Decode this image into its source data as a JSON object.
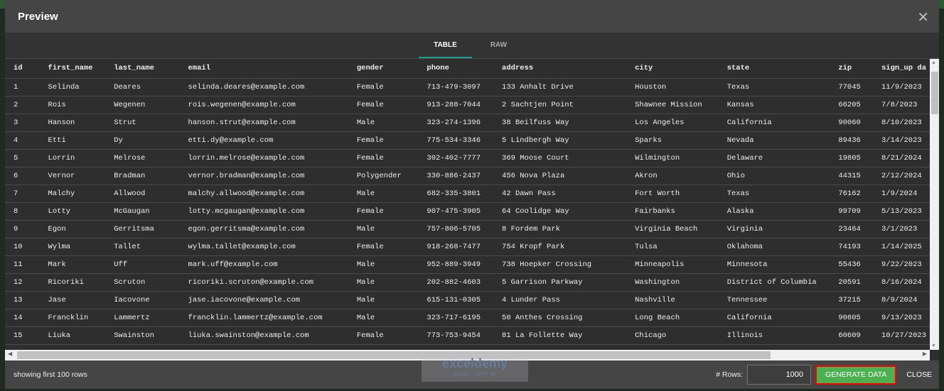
{
  "title": "Preview",
  "tabs": [
    "TABLE",
    "RAW"
  ],
  "columns": [
    "id",
    "first_name",
    "last_name",
    "email",
    "gender",
    "phone",
    "address",
    "city",
    "state",
    "zip",
    "sign_up da"
  ],
  "rows": [
    [
      "1",
      "Selinda",
      "Deares",
      "selinda.deares@example.com",
      "Female",
      "713-479-3097",
      "133 Anhalt Drive",
      "Houston",
      "Texas",
      "77045",
      "11/9/2023"
    ],
    [
      "2",
      "Rois",
      "Wegenen",
      "rois.wegenen@example.com",
      "Female",
      "913-288-7044",
      "2 Sachtjen Point",
      "Shawnee Mission",
      "Kansas",
      "66205",
      "7/8/2023"
    ],
    [
      "3",
      "Hanson",
      "Strut",
      "hanson.strut@example.com",
      "Male",
      "323-274-1396",
      "38 Beilfuss Way",
      "Los Angeles",
      "California",
      "90060",
      "8/10/2023"
    ],
    [
      "4",
      "Etti",
      "Dy",
      "etti.dy@example.com",
      "Female",
      "775-534-3346",
      "5 Lindbergh Way",
      "Sparks",
      "Nevada",
      "89436",
      "3/14/2023"
    ],
    [
      "5",
      "Lorrin",
      "Melrose",
      "lorrin.melrose@example.com",
      "Female",
      "302-402-7777",
      "369 Moose Court",
      "Wilmington",
      "Delaware",
      "19805",
      "8/21/2024"
    ],
    [
      "6",
      "Vernor",
      "Bradman",
      "vernor.bradman@example.com",
      "Polygender",
      "330-886-2437",
      "456 Nova Plaza",
      "Akron",
      "Ohio",
      "44315",
      "2/12/2024"
    ],
    [
      "7",
      "Malchy",
      "Allwood",
      "malchy.allwood@example.com",
      "Male",
      "682-335-3801",
      "42 Dawn Pass",
      "Fort Worth",
      "Texas",
      "76162",
      "1/9/2024"
    ],
    [
      "8",
      "Lotty",
      "McGaugan",
      "lotty.mcgaugan@example.com",
      "Female",
      "907-475-3905",
      "64 Coolidge Way",
      "Fairbanks",
      "Alaska",
      "99709",
      "5/13/2023"
    ],
    [
      "9",
      "Egon",
      "Gerritsma",
      "egon.gerritsma@example.com",
      "Male",
      "757-806-5705",
      "8 Fordem Park",
      "Virginia Beach",
      "Virginia",
      "23464",
      "3/1/2023"
    ],
    [
      "10",
      "Wylma",
      "Tallet",
      "wylma.tallet@example.com",
      "Female",
      "918-268-7477",
      "754 Kropf Park",
      "Tulsa",
      "Oklahoma",
      "74193",
      "1/14/2025"
    ],
    [
      "11",
      "Mark",
      "Uff",
      "mark.uff@example.com",
      "Male",
      "952-889-3949",
      "738 Hoepker Crossing",
      "Minneapolis",
      "Minnesota",
      "55436",
      "9/22/2023"
    ],
    [
      "12",
      "Ricoriki",
      "Scruton",
      "ricoriki.scruton@example.com",
      "Male",
      "202-882-4603",
      "5 Garrison Parkway",
      "Washington",
      "District of Columbia",
      "20591",
      "8/16/2024"
    ],
    [
      "13",
      "Jase",
      "Iacovone",
      "jase.iacovone@example.com",
      "Male",
      "615-131-0305",
      "4 Lunder Pass",
      "Nashville",
      "Tennessee",
      "37215",
      "8/9/2024"
    ],
    [
      "14",
      "Francklin",
      "Lammertz",
      "francklin.lammertz@example.com",
      "Male",
      "323-717-6195",
      "50 Anthes Crossing",
      "Long Beach",
      "California",
      "90805",
      "9/13/2023"
    ],
    [
      "15",
      "Liuka",
      "Swainston",
      "liuka.swainston@example.com",
      "Female",
      "773-753-9454",
      "81 La Follette Way",
      "Chicago",
      "Illinois",
      "60609",
      "10/27/2023"
    ]
  ],
  "footer": {
    "status": "showing first 100 rows",
    "rows_label": "# Rows:",
    "rows_value": "1000",
    "generate": "GENERATE DATA",
    "close": "CLOSE"
  },
  "watermark": {
    "name": "exceldemy",
    "tagline": "EXCEL · DATA · BI"
  }
}
